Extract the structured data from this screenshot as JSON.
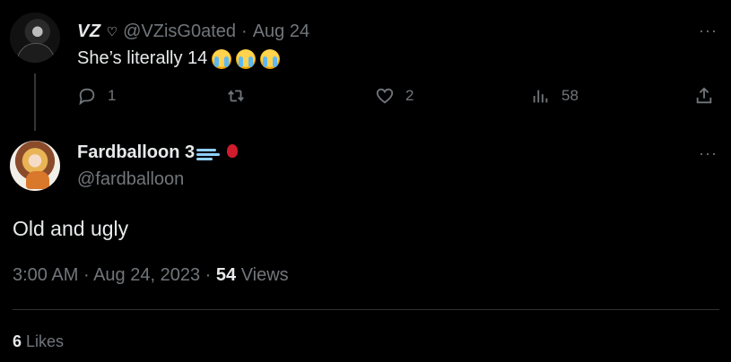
{
  "reply": {
    "display_name": "VZ",
    "name_badge_icon": "heart-outline-icon",
    "handle": "@VZisG0ated",
    "separator": "·",
    "date": "Aug 24",
    "text": "She’s literally 14",
    "emojis": [
      "loudly-crying-face",
      "loudly-crying-face",
      "loudly-crying-face"
    ],
    "actions": {
      "reply_count": "1",
      "retweet_count": "",
      "like_count": "2",
      "view_count": "58"
    }
  },
  "main_tweet": {
    "display_name": "Fardballoon 3",
    "name_emojis": [
      "dashing-away",
      "balloon"
    ],
    "handle": "@fardballoon",
    "text": "Old and ugly",
    "time": "3:00 AM",
    "separator": "·",
    "date": "Aug 24, 2023",
    "views_count": "54",
    "views_label": "Views",
    "likes_count": "6",
    "likes_label": "Likes"
  },
  "more_label": "···",
  "colors": {
    "background": "#000000",
    "text_primary": "#e7e9ea",
    "text_secondary": "#71767b",
    "divider": "#2f3336"
  }
}
